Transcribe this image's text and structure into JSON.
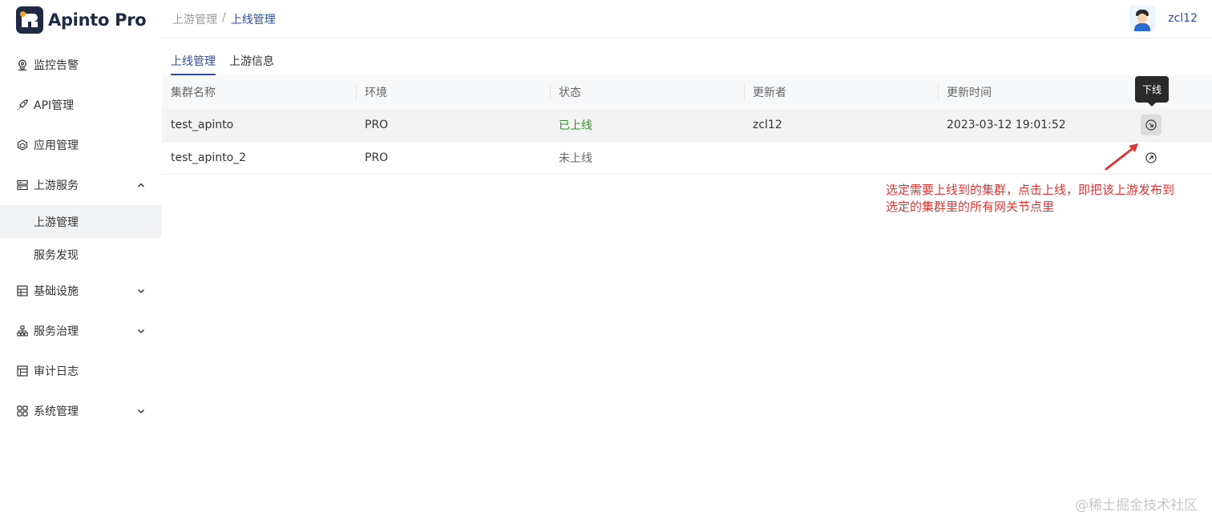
{
  "app": {
    "name": "Apinto Pro"
  },
  "header": {
    "breadcrumb": {
      "parent": "上游管理",
      "separator": "/",
      "current": "上线管理"
    },
    "username": "zcl12"
  },
  "sidebar": {
    "items": [
      {
        "label": "监控告警",
        "icon": "location-pin-icon"
      },
      {
        "label": "API管理",
        "icon": "rocket-icon"
      },
      {
        "label": "应用管理",
        "icon": "cube-icon"
      },
      {
        "label": "上游服务",
        "icon": "server-icon",
        "expanded": true,
        "children": [
          {
            "label": "上游管理",
            "active": true
          },
          {
            "label": "服务发现"
          }
        ]
      },
      {
        "label": "基础设施",
        "icon": "database-icon"
      },
      {
        "label": "服务治理",
        "icon": "sitemap-icon"
      },
      {
        "label": "审计日志",
        "icon": "table-icon"
      },
      {
        "label": "系统管理",
        "icon": "grid-icon"
      }
    ]
  },
  "tabs": [
    {
      "label": "上线管理",
      "active": true
    },
    {
      "label": "上游信息",
      "active": false
    }
  ],
  "table": {
    "headers": [
      "集群名称",
      "环境",
      "状态",
      "更新者",
      "更新时间"
    ],
    "rows": [
      {
        "cluster": "test_apinto",
        "env": "PRO",
        "status": "已上线",
        "updater": "zcl12",
        "updated_at": "2023-03-12 19:01:52",
        "action_icon": "offline-arrow-icon"
      },
      {
        "cluster": "test_apinto_2",
        "env": "PRO",
        "status": "未上线",
        "updater": "",
        "updated_at": "",
        "action_icon": "online-arrow-icon"
      }
    ]
  },
  "tooltip": {
    "text": "下线"
  },
  "annotation": {
    "text": "选定需要上线到的集群，点击上线，即把该上游发布到选定的集群里的所有网关节点里"
  },
  "watermark": "@稀土掘金技术社区",
  "colors": {
    "accent": "#2b4ea2",
    "online": "#2f8f2f",
    "annotation": "#e03535"
  }
}
